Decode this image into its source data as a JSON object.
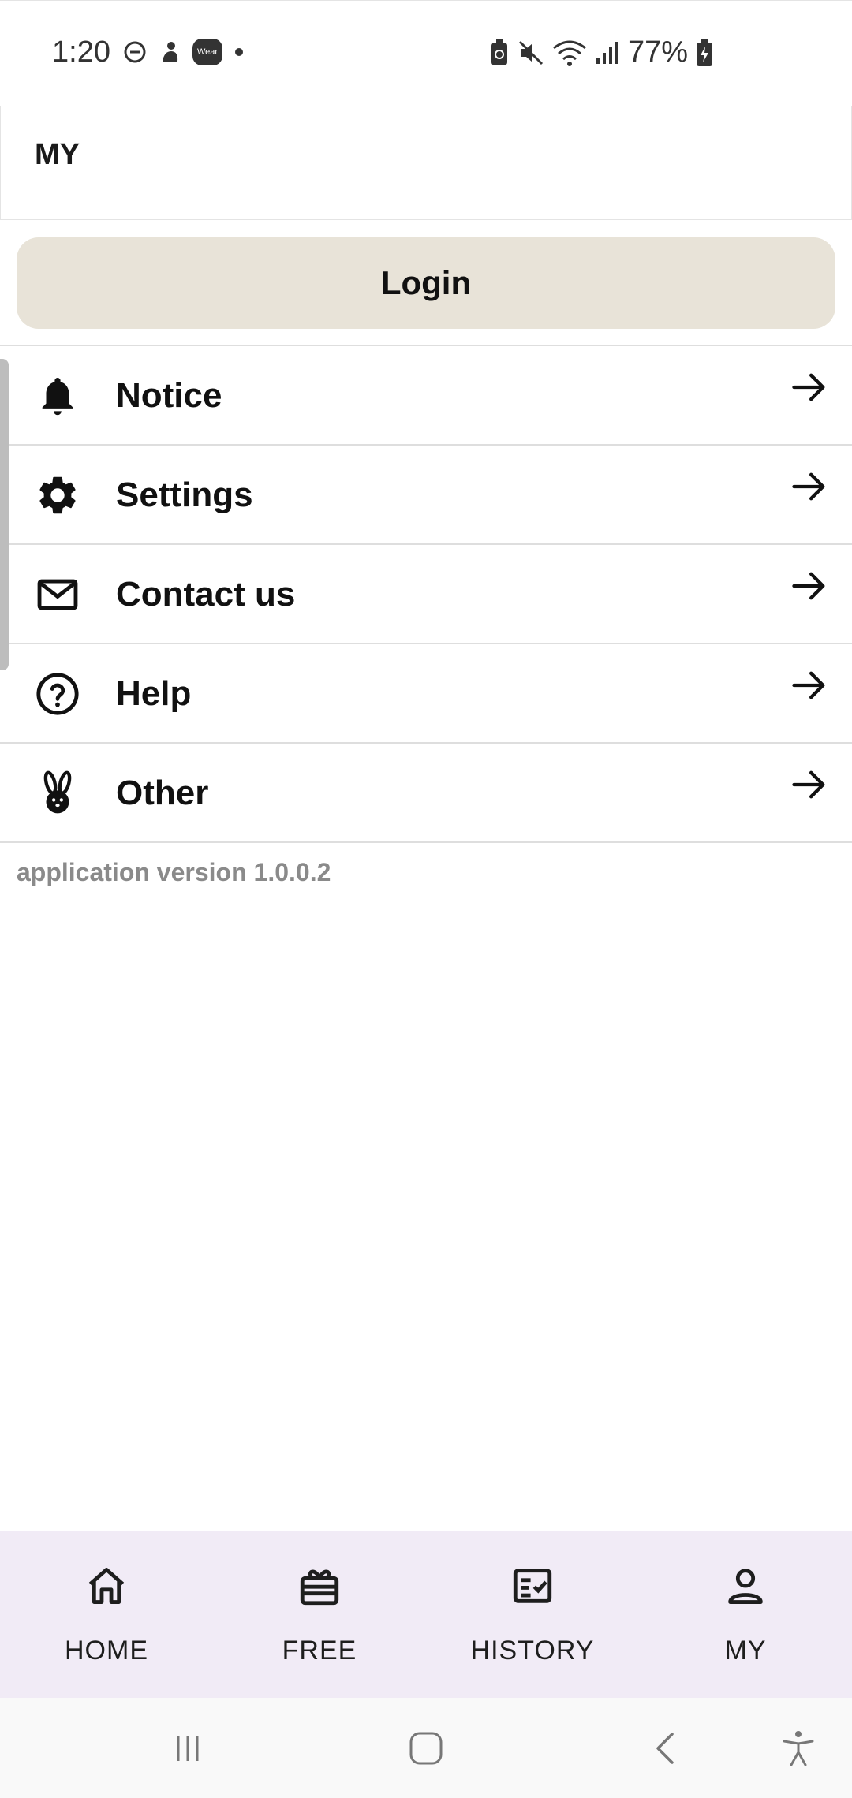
{
  "status_bar": {
    "time": "1:20",
    "battery_percent": "77%",
    "left_icons": [
      "do-not-disturb-icon",
      "fitness-app-icon",
      "wear-app-icon",
      "notification-dot-icon"
    ],
    "wear_badge": "Wear",
    "right_icons": [
      "battery-saver-icon",
      "mute-icon",
      "wifi-icon",
      "signal-icon",
      "battery-charging-icon"
    ]
  },
  "header": {
    "title": "MY"
  },
  "login_button": {
    "label": "Login"
  },
  "menu": {
    "items": [
      {
        "label": "Notice",
        "icon": "bell-icon"
      },
      {
        "label": "Settings",
        "icon": "gear-icon"
      },
      {
        "label": "Contact us",
        "icon": "mail-icon"
      },
      {
        "label": "Help",
        "icon": "help-circle-icon"
      },
      {
        "label": "Other",
        "icon": "rabbit-icon"
      }
    ],
    "arrow_icon": "arrow-right-icon"
  },
  "version_text": "application version 1.0.0.2",
  "bottom_nav": {
    "items": [
      {
        "label": "HOME",
        "icon": "home-icon"
      },
      {
        "label": "FREE",
        "icon": "gift-icon"
      },
      {
        "label": "HISTORY",
        "icon": "history-checklist-icon"
      },
      {
        "label": "MY",
        "icon": "person-icon"
      }
    ],
    "active": "MY"
  },
  "system_nav": [
    "recents-button",
    "home-button",
    "back-button",
    "accessibility-button"
  ],
  "colors": {
    "login_button_bg": "#e8e3d8",
    "bottom_nav_bg": "#f1ebf6",
    "divider": "#dedede",
    "version_text": "#8a8a8a"
  }
}
